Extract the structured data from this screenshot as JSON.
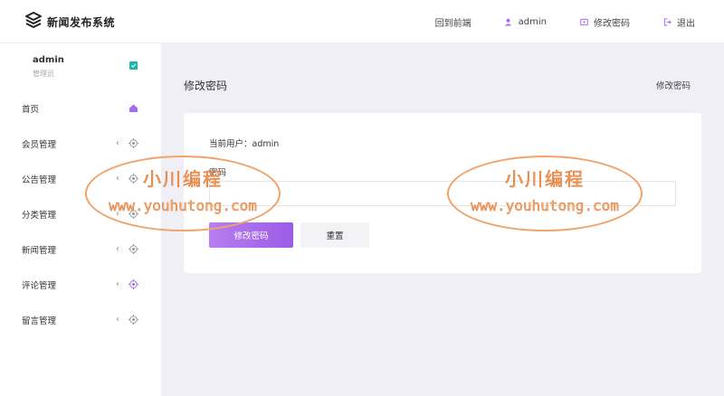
{
  "header": {
    "app_title": "新闻发布系统",
    "nav": [
      {
        "label": "回到前端",
        "icon": "home-link"
      },
      {
        "label": "admin",
        "icon": "user-icon"
      },
      {
        "label": "修改密码",
        "icon": "password-icon"
      },
      {
        "label": "退出",
        "icon": "logout-icon"
      }
    ]
  },
  "sidebar": {
    "user": {
      "name": "admin",
      "role": "管理员"
    },
    "items": [
      {
        "label": "首页",
        "icon": "home-icon",
        "expandable": false
      },
      {
        "label": "会员管理",
        "icon": "target-icon",
        "expandable": true
      },
      {
        "label": "公告管理",
        "icon": "target-icon",
        "expandable": true
      },
      {
        "label": "分类管理",
        "icon": "target-icon",
        "expandable": true
      },
      {
        "label": "新闻管理",
        "icon": "target-icon",
        "expandable": true
      },
      {
        "label": "评论管理",
        "icon": "target-icon",
        "expandable": true
      },
      {
        "label": "留言管理",
        "icon": "target-icon",
        "expandable": true
      }
    ]
  },
  "main": {
    "title": "修改密码",
    "breadcrumb": "修改密码",
    "form": {
      "current_user_label": "当前用户：admin",
      "password_label": "密码",
      "password_value": "",
      "submit_label": "修改密码",
      "reset_label": "重置"
    }
  },
  "watermark": {
    "line1": "小川编程",
    "line2": "www.youhutong.com"
  },
  "colors": {
    "accent": "#a66ceb",
    "teal": "#1fb5ac",
    "main_bg": "#f1eff6",
    "watermark": "#f0a36a"
  }
}
